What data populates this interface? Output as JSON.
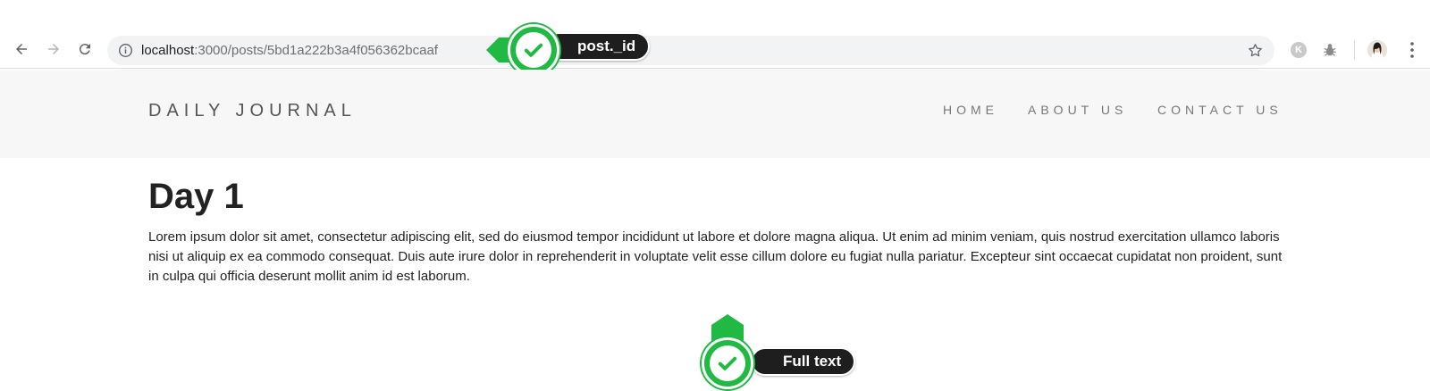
{
  "browser": {
    "url_host": "localhost",
    "url_path": ":3000/posts/5bd1a222b3a4f056362bcaaf",
    "extension_k_label": "K",
    "icons": [
      "back-icon",
      "forward-icon",
      "reload-icon",
      "info-icon",
      "star-icon",
      "bug-icon",
      "menu-dots-icon"
    ]
  },
  "site": {
    "brand": "DAILY JOURNAL",
    "nav": {
      "home": "HOME",
      "about": "ABOUT US",
      "contact": "CONTACT US"
    }
  },
  "post": {
    "title": "Day 1",
    "body": "Lorem ipsum dolor sit amet, consectetur adipiscing elit, sed do eiusmod tempor incididunt ut labore et dolore magna aliqua. Ut enim ad minim veniam, quis nostrud exercitation ullamco laboris nisi ut aliquip ex ea commodo consequat. Duis aute irure dolor in reprehenderit in voluptate velit esse cillum dolore eu fugiat nulla pariatur. Excepteur sint occaecat cupidatat non proident, sunt in culpa qui officia deserunt mollit anim id est laborum."
  },
  "annotations": {
    "url_badge": "post._id",
    "text_badge": "Full text"
  },
  "colors": {
    "badge_green": "#1fb943",
    "badge_dark": "#1e1e1e",
    "header_bg": "#f7f7f7"
  }
}
